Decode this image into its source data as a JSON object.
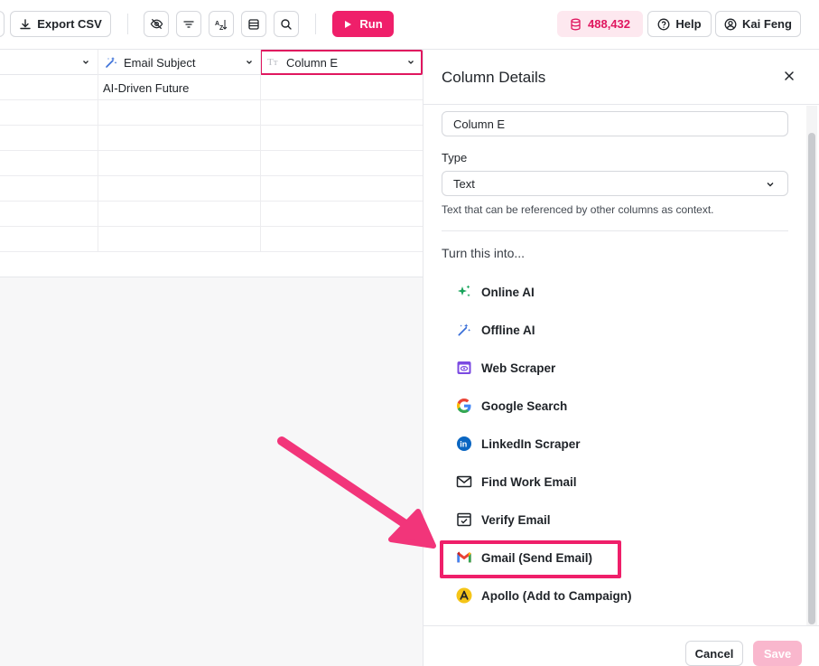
{
  "toolbar": {
    "export_label": "Export CSV",
    "run_label": "Run",
    "credits": "488,432",
    "help_label": "Help",
    "user_name": "Kai Feng"
  },
  "grid": {
    "columns": [
      {
        "label": ""
      },
      {
        "label": "Email Subject"
      },
      {
        "label": "Column E"
      }
    ],
    "first_row_email_subject": "AI-Driven Future"
  },
  "panel": {
    "title": "Column Details",
    "column_name": "Column E",
    "type_label": "Type",
    "type_value": "Text",
    "type_help": "Text that can be referenced by other columns as context.",
    "turn_into_label": "Turn this into...",
    "options": [
      {
        "label": "Online AI",
        "icon": "sparkle-icon"
      },
      {
        "label": "Offline AI",
        "icon": "magic-wand-icon"
      },
      {
        "label": "Web Scraper",
        "icon": "web-scraper-icon"
      },
      {
        "label": "Google Search",
        "icon": "google-icon"
      },
      {
        "label": "LinkedIn Scraper",
        "icon": "linkedin-icon"
      },
      {
        "label": "Find Work Email",
        "icon": "envelope-icon"
      },
      {
        "label": "Verify Email",
        "icon": "verify-email-icon"
      },
      {
        "label": "Gmail (Send Email)",
        "icon": "gmail-icon"
      },
      {
        "label": "Apollo (Add to Campaign)",
        "icon": "apollo-icon"
      }
    ],
    "cancel_label": "Cancel",
    "save_label": "Save"
  },
  "colors": {
    "accent": "#ef1f6a",
    "credits_bg": "#fde8ef",
    "save_disabled": "#f9b7cd"
  }
}
